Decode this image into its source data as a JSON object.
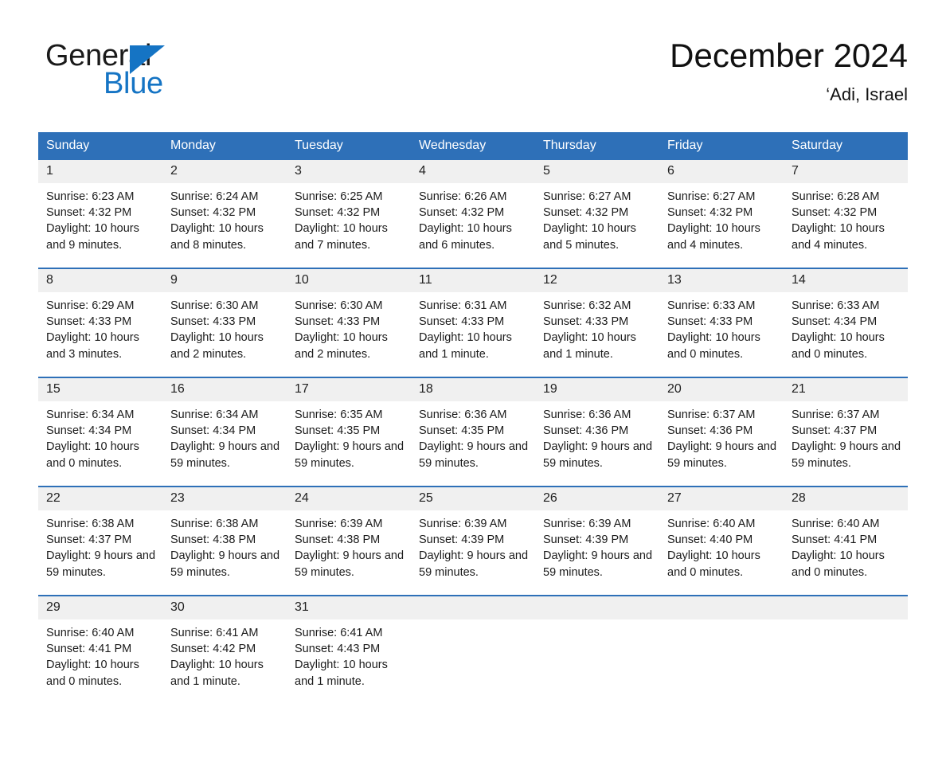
{
  "brand": {
    "name_part1": "General",
    "name_part2": "Blue",
    "logo_icon": "triangle-logo-icon",
    "blue": "#1574c4"
  },
  "header": {
    "title": "December 2024",
    "location": "‘Adi, Israel"
  },
  "colors": {
    "header_blue": "#2e70b8",
    "row_divider_blue": "#2e70b8",
    "daynum_band": "#f0f0f0",
    "text": "#1b1b1b"
  },
  "weekday_headers": [
    "Sunday",
    "Monday",
    "Tuesday",
    "Wednesday",
    "Thursday",
    "Friday",
    "Saturday"
  ],
  "labels": {
    "sunrise_prefix": "Sunrise:",
    "sunset_prefix": "Sunset:",
    "daylight_prefix": "Daylight:"
  },
  "weeks": [
    [
      {
        "day": "1",
        "sunrise": "Sunrise: 6:23 AM",
        "sunset": "Sunset: 4:32 PM",
        "daylight": "Daylight: 10 hours and 9 minutes."
      },
      {
        "day": "2",
        "sunrise": "Sunrise: 6:24 AM",
        "sunset": "Sunset: 4:32 PM",
        "daylight": "Daylight: 10 hours and 8 minutes."
      },
      {
        "day": "3",
        "sunrise": "Sunrise: 6:25 AM",
        "sunset": "Sunset: 4:32 PM",
        "daylight": "Daylight: 10 hours and 7 minutes."
      },
      {
        "day": "4",
        "sunrise": "Sunrise: 6:26 AM",
        "sunset": "Sunset: 4:32 PM",
        "daylight": "Daylight: 10 hours and 6 minutes."
      },
      {
        "day": "5",
        "sunrise": "Sunrise: 6:27 AM",
        "sunset": "Sunset: 4:32 PM",
        "daylight": "Daylight: 10 hours and 5 minutes."
      },
      {
        "day": "6",
        "sunrise": "Sunrise: 6:27 AM",
        "sunset": "Sunset: 4:32 PM",
        "daylight": "Daylight: 10 hours and 4 minutes."
      },
      {
        "day": "7",
        "sunrise": "Sunrise: 6:28 AM",
        "sunset": "Sunset: 4:32 PM",
        "daylight": "Daylight: 10 hours and 4 minutes."
      }
    ],
    [
      {
        "day": "8",
        "sunrise": "Sunrise: 6:29 AM",
        "sunset": "Sunset: 4:33 PM",
        "daylight": "Daylight: 10 hours and 3 minutes."
      },
      {
        "day": "9",
        "sunrise": "Sunrise: 6:30 AM",
        "sunset": "Sunset: 4:33 PM",
        "daylight": "Daylight: 10 hours and 2 minutes."
      },
      {
        "day": "10",
        "sunrise": "Sunrise: 6:30 AM",
        "sunset": "Sunset: 4:33 PM",
        "daylight": "Daylight: 10 hours and 2 minutes."
      },
      {
        "day": "11",
        "sunrise": "Sunrise: 6:31 AM",
        "sunset": "Sunset: 4:33 PM",
        "daylight": "Daylight: 10 hours and 1 minute."
      },
      {
        "day": "12",
        "sunrise": "Sunrise: 6:32 AM",
        "sunset": "Sunset: 4:33 PM",
        "daylight": "Daylight: 10 hours and 1 minute."
      },
      {
        "day": "13",
        "sunrise": "Sunrise: 6:33 AM",
        "sunset": "Sunset: 4:33 PM",
        "daylight": "Daylight: 10 hours and 0 minutes."
      },
      {
        "day": "14",
        "sunrise": "Sunrise: 6:33 AM",
        "sunset": "Sunset: 4:34 PM",
        "daylight": "Daylight: 10 hours and 0 minutes."
      }
    ],
    [
      {
        "day": "15",
        "sunrise": "Sunrise: 6:34 AM",
        "sunset": "Sunset: 4:34 PM",
        "daylight": "Daylight: 10 hours and 0 minutes."
      },
      {
        "day": "16",
        "sunrise": "Sunrise: 6:34 AM",
        "sunset": "Sunset: 4:34 PM",
        "daylight": "Daylight: 9 hours and 59 minutes."
      },
      {
        "day": "17",
        "sunrise": "Sunrise: 6:35 AM",
        "sunset": "Sunset: 4:35 PM",
        "daylight": "Daylight: 9 hours and 59 minutes."
      },
      {
        "day": "18",
        "sunrise": "Sunrise: 6:36 AM",
        "sunset": "Sunset: 4:35 PM",
        "daylight": "Daylight: 9 hours and 59 minutes."
      },
      {
        "day": "19",
        "sunrise": "Sunrise: 6:36 AM",
        "sunset": "Sunset: 4:36 PM",
        "daylight": "Daylight: 9 hours and 59 minutes."
      },
      {
        "day": "20",
        "sunrise": "Sunrise: 6:37 AM",
        "sunset": "Sunset: 4:36 PM",
        "daylight": "Daylight: 9 hours and 59 minutes."
      },
      {
        "day": "21",
        "sunrise": "Sunrise: 6:37 AM",
        "sunset": "Sunset: 4:37 PM",
        "daylight": "Daylight: 9 hours and 59 minutes."
      }
    ],
    [
      {
        "day": "22",
        "sunrise": "Sunrise: 6:38 AM",
        "sunset": "Sunset: 4:37 PM",
        "daylight": "Daylight: 9 hours and 59 minutes."
      },
      {
        "day": "23",
        "sunrise": "Sunrise: 6:38 AM",
        "sunset": "Sunset: 4:38 PM",
        "daylight": "Daylight: 9 hours and 59 minutes."
      },
      {
        "day": "24",
        "sunrise": "Sunrise: 6:39 AM",
        "sunset": "Sunset: 4:38 PM",
        "daylight": "Daylight: 9 hours and 59 minutes."
      },
      {
        "day": "25",
        "sunrise": "Sunrise: 6:39 AM",
        "sunset": "Sunset: 4:39 PM",
        "daylight": "Daylight: 9 hours and 59 minutes."
      },
      {
        "day": "26",
        "sunrise": "Sunrise: 6:39 AM",
        "sunset": "Sunset: 4:39 PM",
        "daylight": "Daylight: 9 hours and 59 minutes."
      },
      {
        "day": "27",
        "sunrise": "Sunrise: 6:40 AM",
        "sunset": "Sunset: 4:40 PM",
        "daylight": "Daylight: 10 hours and 0 minutes."
      },
      {
        "day": "28",
        "sunrise": "Sunrise: 6:40 AM",
        "sunset": "Sunset: 4:41 PM",
        "daylight": "Daylight: 10 hours and 0 minutes."
      }
    ],
    [
      {
        "day": "29",
        "sunrise": "Sunrise: 6:40 AM",
        "sunset": "Sunset: 4:41 PM",
        "daylight": "Daylight: 10 hours and 0 minutes."
      },
      {
        "day": "30",
        "sunrise": "Sunrise: 6:41 AM",
        "sunset": "Sunset: 4:42 PM",
        "daylight": "Daylight: 10 hours and 1 minute."
      },
      {
        "day": "31",
        "sunrise": "Sunrise: 6:41 AM",
        "sunset": "Sunset: 4:43 PM",
        "daylight": "Daylight: 10 hours and 1 minute."
      },
      {
        "day": "",
        "sunrise": "",
        "sunset": "",
        "daylight": ""
      },
      {
        "day": "",
        "sunrise": "",
        "sunset": "",
        "daylight": ""
      },
      {
        "day": "",
        "sunrise": "",
        "sunset": "",
        "daylight": ""
      },
      {
        "day": "",
        "sunrise": "",
        "sunset": "",
        "daylight": ""
      }
    ]
  ]
}
